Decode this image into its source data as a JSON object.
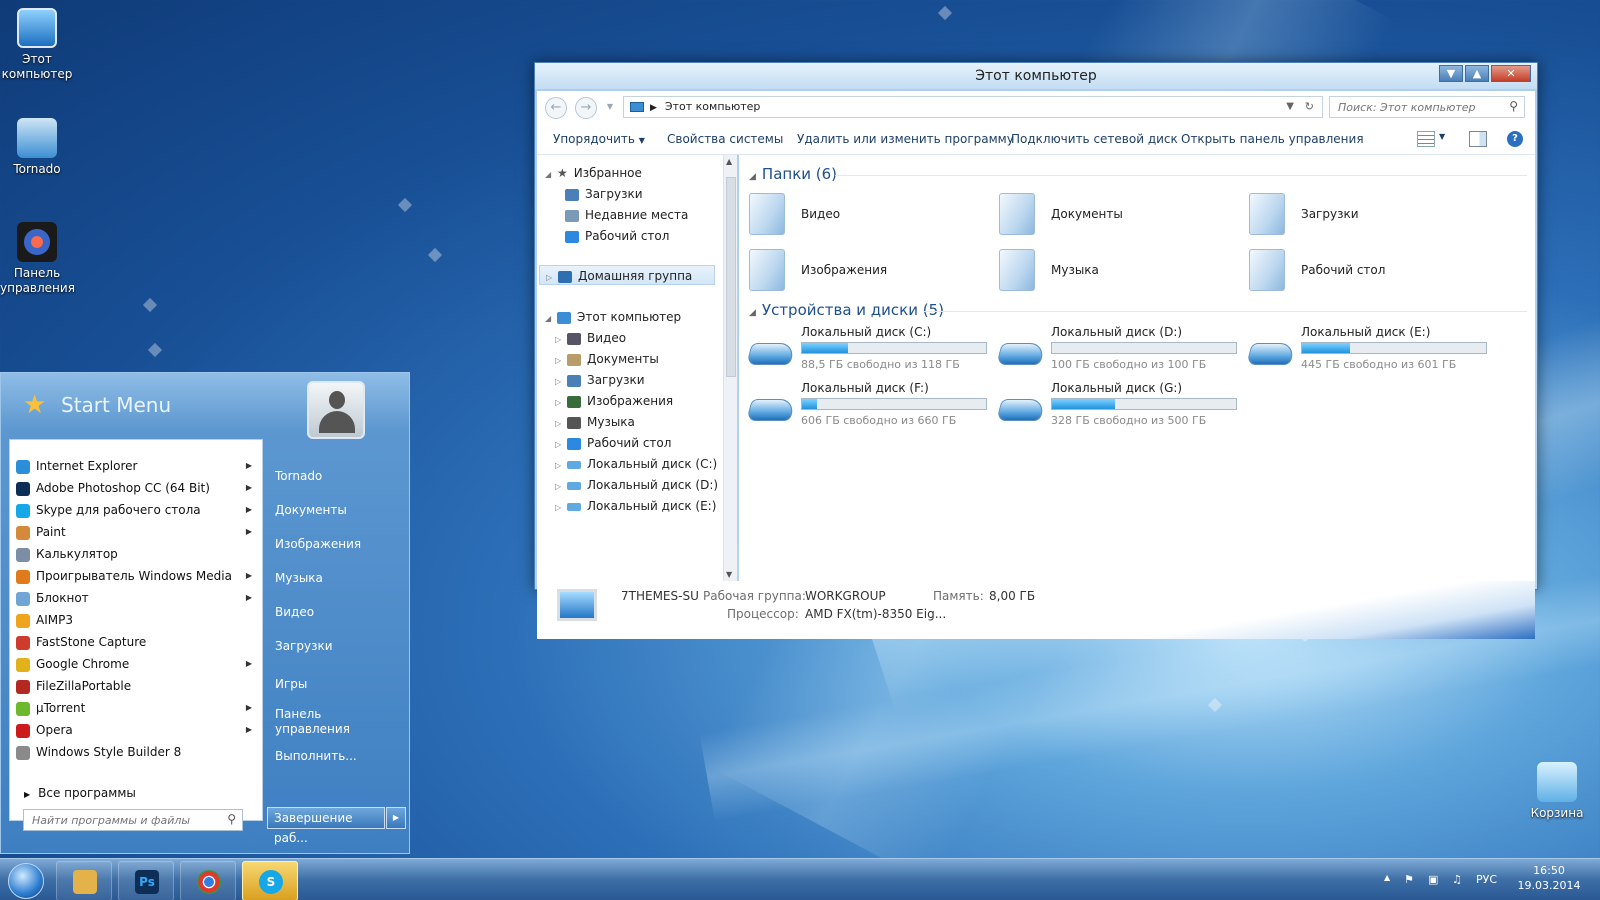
{
  "desktop": {
    "icons": [
      {
        "label": "Этот компьютер",
        "icon": "computer-icon"
      },
      {
        "label": "Tornado",
        "icon": "user-folder-icon"
      },
      {
        "label": "Панель управления",
        "icon": "control-panel-icon"
      },
      {
        "label": "Корзина",
        "icon": "recycle-bin-icon"
      }
    ]
  },
  "explorer": {
    "title": "Этот компьютер",
    "address": "Этот компьютер",
    "search_placeholder": "Поиск: Этот компьютер",
    "toolbar": [
      "Упорядочить",
      "Свойства системы",
      "Удалить или изменить программу",
      "Подключить сетевой диск",
      "Открыть панель управления"
    ],
    "nav": {
      "favorites": "Избранное",
      "favorites_items": [
        "Загрузки",
        "Недавние места",
        "Рабочий стол"
      ],
      "homegroup": "Домашняя группа",
      "computer": "Этот компьютер",
      "computer_items": [
        "Видео",
        "Документы",
        "Загрузки",
        "Изображения",
        "Музыка",
        "Рабочий стол",
        "Локальный диск (C:)",
        "Локальный диск (D:)",
        "Локальный диск (E:)"
      ]
    },
    "folders_header": "Папки (6)",
    "folders": [
      "Видео",
      "Документы",
      "Загрузки",
      "Изображения",
      "Музыка",
      "Рабочий стол"
    ],
    "drives_header": "Устройства и диски (5)",
    "drives": [
      {
        "name": "Локальный диск (C:)",
        "free": "88,5 ГБ свободно из 118 ГБ",
        "used_fraction": 0.25
      },
      {
        "name": "Локальный диск (D:)",
        "free": "100 ГБ свободно из 100 ГБ",
        "used_fraction": 0.0
      },
      {
        "name": "Локальный диск (E:)",
        "free": "445 ГБ свободно из 601 ГБ",
        "used_fraction": 0.26
      },
      {
        "name": "Локальный диск (F:)",
        "free": "606 ГБ свободно из 660 ГБ",
        "used_fraction": 0.08
      },
      {
        "name": "Локальный диск (G:)",
        "free": "328 ГБ свободно из 500 ГБ",
        "used_fraction": 0.34
      }
    ],
    "details": {
      "computer_name": "7THEMES-SU",
      "workgroup_label": "Рабочая группа:",
      "workgroup": "WORKGROUP",
      "memory_label": "Память:",
      "memory": "8,00 ГБ",
      "cpu_label": "Процессор:",
      "cpu": "AMD FX(tm)-8350 Eig..."
    }
  },
  "start_menu": {
    "title": "Start Menu",
    "programs": [
      {
        "label": "Internet Explorer",
        "submenu": true,
        "color": "#2a8fd8"
      },
      {
        "label": "Adobe Photoshop CC (64 Bit)",
        "submenu": true,
        "color": "#0d2f57"
      },
      {
        "label": "Skype для рабочего стола",
        "submenu": true,
        "color": "#16a7e8"
      },
      {
        "label": "Paint",
        "submenu": true,
        "color": "#d58a3b"
      },
      {
        "label": "Калькулятор",
        "submenu": false,
        "color": "#7b8ea3"
      },
      {
        "label": "Проигрыватель Windows Media",
        "submenu": true,
        "color": "#e07a1b"
      },
      {
        "label": "Блокнот",
        "submenu": true,
        "color": "#6fa6d6"
      },
      {
        "label": "AIMP3",
        "submenu": false,
        "color": "#f0a31d"
      },
      {
        "label": "FastStone Capture",
        "submenu": false,
        "color": "#cf3b2c"
      },
      {
        "label": "Google Chrome",
        "submenu": true,
        "color": "#e2b21d"
      },
      {
        "label": "FileZillaPortable",
        "submenu": false,
        "color": "#b32820"
      },
      {
        "label": "µTorrent",
        "submenu": true,
        "color": "#6eb82d"
      },
      {
        "label": "Opera",
        "submenu": true,
        "color": "#cc1b1b"
      },
      {
        "label": "Windows Style Builder 8",
        "submenu": false,
        "color": "#8a8a8a"
      }
    ],
    "all_programs": "Все программы",
    "right_items": [
      "Tornado",
      "Документы",
      "Изображения",
      "Музыка",
      "Видео",
      "Загрузки",
      "Игры",
      "Панель управления",
      "Выполнить..."
    ],
    "search_placeholder": "Найти программы и файлы",
    "shutdown": "Завершение раб..."
  },
  "taskbar": {
    "apps": [
      {
        "name": "explorer",
        "icon": "folder-icon",
        "color": "#e3b24a",
        "text": ""
      },
      {
        "name": "photoshop",
        "icon": "photoshop-icon",
        "color": "#0d2f57",
        "text": "Ps"
      },
      {
        "name": "chrome",
        "icon": "chrome-icon",
        "color": "#2f9c44",
        "text": ""
      },
      {
        "name": "skype",
        "icon": "skype-icon",
        "color": "#16a7e8",
        "text": "S"
      }
    ],
    "lang": "РУС",
    "time": "16:50",
    "date": "19.03.2014"
  }
}
